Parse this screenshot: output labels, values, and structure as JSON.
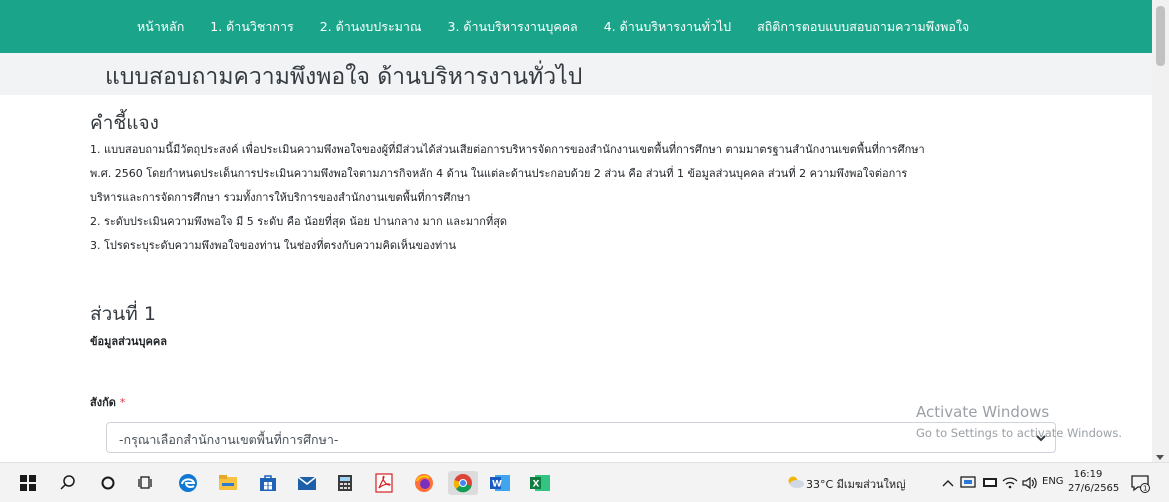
{
  "nav": {
    "items": [
      {
        "label": "หน้าหลัก"
      },
      {
        "label": "1. ด้านวิชาการ"
      },
      {
        "label": "2. ด้านงบประมาณ"
      },
      {
        "label": "3. ด้านบริหารงานบุคคล"
      },
      {
        "label": "4. ด้านบริหารงานทั่วไป"
      },
      {
        "label": "สถิติการตอบแบบสอบถามความพึงพอใจ"
      }
    ],
    "bg_color": "#1aa58a"
  },
  "page": {
    "title": "แบบสอบถามความพึงพอใจ ด้านบริหารงานทั่วไป"
  },
  "instructions": {
    "heading": "คำชี้แจง",
    "lines": [
      "1. แบบสอบถามนี้มีวัตถุประสงค์ เพื่อประเมินความพึงพอใจของผู้ที่มีส่วนได้ส่วนเสียต่อการบริหารจัดการของสำนักงานเขตพื้นที่การศึกษา ตามมาตรฐานสำนักงานเขตพื้นที่การศึกษา",
      "พ.ศ. 2560 โดยกำหนดประเด็นการประเมินความพึงพอใจตามภารกิจหลัก 4 ด้าน ในแต่ละด้านประกอบด้วย 2 ส่วน คือ ส่วนที่ 1 ข้อมูลส่วนบุคคล ส่วนที่ 2 ความพึงพอใจต่อการ",
      "บริหารและการจัดการศึกษา รวมทั้งการให้บริการของสำนักงานเขตพื้นที่การศึกษา",
      "2. ระดับประเมินความพึงพอใจ มี 5 ระดับ คือ น้อยที่สุด น้อย ปานกลาง มาก และมากที่สุด",
      "3. โปรดระบุระดับความพึงพอใจของท่าน ในช่องที่ตรงกับความคิดเห็นของท่าน"
    ]
  },
  "part1": {
    "heading": "ส่วนที่ 1",
    "subheading": "ข้อมูลส่วนบุคคล",
    "field_label": "สังกัด",
    "required_mark": "*",
    "select_value": "-กรุณาเลือกสำนักงานเขตพื้นที่การศึกษา-"
  },
  "watermark": {
    "line1": "Activate Windows",
    "line2": "Go to Settings to activate Windows."
  },
  "taskbar": {
    "icons": [
      "windows-start-icon",
      "search-icon",
      "cortana-icon",
      "task-view-icon",
      "edge-icon",
      "file-explorer-icon",
      "store-icon",
      "mail-icon",
      "calculator-icon",
      "acrobat-icon",
      "firefox-icon",
      "chrome-icon",
      "word-icon",
      "excel-icon"
    ],
    "weather": "33°C มีเมฆส่วนใหญ่",
    "lang": "ENG",
    "time": "16:19",
    "date": "27/6/2565"
  }
}
